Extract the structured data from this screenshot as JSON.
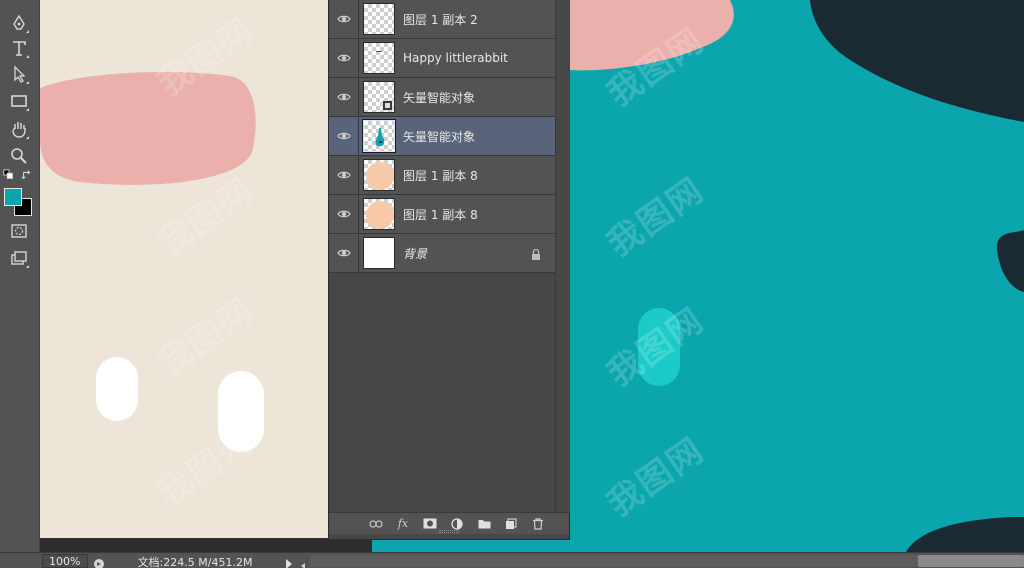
{
  "tools": [
    {
      "name": "pen-tool-icon"
    },
    {
      "name": "type-tool-icon"
    },
    {
      "name": "path-selection-icon"
    },
    {
      "name": "rectangle-tool-icon"
    },
    {
      "name": "hand-tool-icon"
    },
    {
      "name": "zoom-tool-icon"
    },
    {
      "name": "quick-mask-icon"
    },
    {
      "name": "screen-mode-icon"
    }
  ],
  "colors": {
    "foreground": "#0ba5ae",
    "background": "#000000",
    "canvas_cream": "#ece5d8",
    "canvas_teal": "#0ba5ae",
    "pink": "#ebb0ab",
    "navy": "#1a2a33",
    "light_teal": "#1ccbc9"
  },
  "layers": [
    {
      "name": "图层 1 副本 2",
      "selected": false,
      "thumb": "transparent"
    },
    {
      "name": "Happy littlerabbit",
      "selected": false,
      "thumb": "transparent"
    },
    {
      "name": "矢量智能对象",
      "selected": false,
      "thumb": "smart"
    },
    {
      "name": "矢量智能对象",
      "selected": true,
      "thumb": "rabbit"
    },
    {
      "name": "图层 1 副本 8",
      "selected": false,
      "thumb": "peach"
    },
    {
      "name": "图层 1 副本 8",
      "selected": false,
      "thumb": "peach"
    },
    {
      "name": "背景",
      "selected": false,
      "thumb": "white",
      "locked": true
    }
  ],
  "footer_icons": [
    "link-layers-icon",
    "fx-icon",
    "add-mask-icon",
    "adjustment-layer-icon",
    "new-group-icon",
    "new-layer-icon",
    "delete-layer-icon"
  ],
  "fx_label": "fx",
  "status": {
    "zoom": "100%",
    "doc_info": "文档:224.5 M/451.2M"
  },
  "watermark_text": "我图网"
}
